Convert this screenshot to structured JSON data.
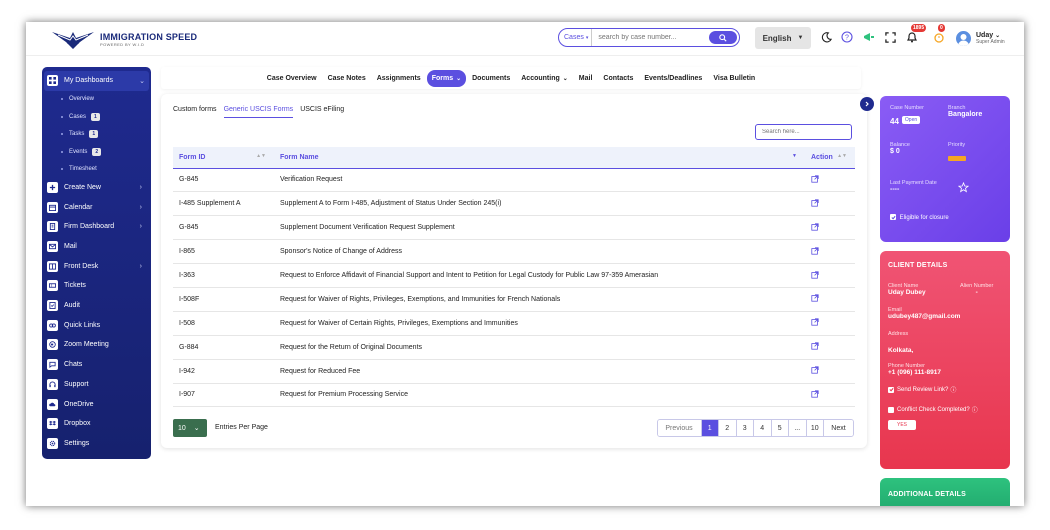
{
  "header": {
    "logo_title": "IMMIGRATION SPEED",
    "logo_sub": "POWERED BY W.I.D",
    "search_scope": "Cases",
    "search_placeholder": "search by case number...",
    "language": "English",
    "notification_count": "1895",
    "reminder_count": "0",
    "user_name": "Uday",
    "user_role": "Super Admin"
  },
  "sidebar": {
    "dashboard_label": "My Dashboards",
    "dashboard_sub": [
      {
        "label": "Overview",
        "count": ""
      },
      {
        "label": "Cases",
        "count": "1"
      },
      {
        "label": "Tasks",
        "count": "1"
      },
      {
        "label": "Events",
        "count": "2"
      },
      {
        "label": "Timesheet",
        "count": ""
      }
    ],
    "items": [
      {
        "label": "Create New",
        "icon": "plus-icon",
        "chevron": true
      },
      {
        "label": "Calendar",
        "icon": "calendar-icon",
        "chevron": true
      },
      {
        "label": "Firm Dashboard",
        "icon": "building-icon",
        "chevron": true
      },
      {
        "label": "Mail",
        "icon": "mail-icon",
        "chevron": false
      },
      {
        "label": "Front Desk",
        "icon": "desk-icon",
        "chevron": true
      },
      {
        "label": "Tickets",
        "icon": "ticket-icon",
        "chevron": false
      },
      {
        "label": "Audit",
        "icon": "audit-icon",
        "chevron": false
      },
      {
        "label": "Quick Links",
        "icon": "link-icon",
        "chevron": false
      },
      {
        "label": "Zoom Meeting",
        "icon": "video-icon",
        "chevron": false
      },
      {
        "label": "Chats",
        "icon": "chat-icon",
        "chevron": false
      },
      {
        "label": "Support",
        "icon": "support-icon",
        "chevron": false
      },
      {
        "label": "OneDrive",
        "icon": "cloud-icon",
        "chevron": false
      },
      {
        "label": "Dropbox",
        "icon": "dropbox-icon",
        "chevron": false
      },
      {
        "label": "Settings",
        "icon": "gear-icon",
        "chevron": false
      }
    ]
  },
  "tabs": [
    "Case Overview",
    "Case Notes",
    "Assignments",
    "Forms",
    "Documents",
    "Accounting",
    "Mail",
    "Contacts",
    "Events/Deadlines",
    "Visa Bulletin"
  ],
  "active_tab": "Forms",
  "subtabs": [
    "Custom forms",
    "Generic USCIS Forms",
    "USCIS eFiling"
  ],
  "active_subtab": "Generic USCIS Forms",
  "table": {
    "search_placeholder": "Search here...",
    "headers": {
      "id": "Form ID",
      "name": "Form Name",
      "action": "Action"
    },
    "rows": [
      {
        "id": "G-845",
        "name": "Verification Request"
      },
      {
        "id": "I-485 Supplement A",
        "name": "Supplement A to Form I-485, Adjustment of Status Under Section 245(i)"
      },
      {
        "id": "G-845",
        "name": "Supplement Document Verification Request Supplement"
      },
      {
        "id": "I-865",
        "name": "Sponsor's Notice of Change of Address"
      },
      {
        "id": "I-363",
        "name": "Request to Enforce Affidavit of Financial Support and Intent to Petition for Legal Custody for Public Law 97-359 Amerasian"
      },
      {
        "id": "I-508F",
        "name": "Request for Waiver of Rights, Privileges, Exemptions, and Immunities for French Nationals"
      },
      {
        "id": "I-508",
        "name": "Request for Waiver of Certain Rights, Privileges, Exemptions and Immunities"
      },
      {
        "id": "G-884",
        "name": "Request for the Return of Original Documents"
      },
      {
        "id": "I-942",
        "name": "Request for Reduced Fee"
      },
      {
        "id": "I-907",
        "name": "Request for Premium Processing Service"
      }
    ],
    "per_page_value": "10",
    "per_page_label": "Entries Per Page",
    "pagination": [
      "Previous",
      "1",
      "2",
      "3",
      "4",
      "5",
      "...",
      "10",
      "Next"
    ],
    "active_page": "1"
  },
  "case_card": {
    "case_number_label": "Case Number",
    "case_number": "44",
    "status": "Open",
    "branch_label": "Branch",
    "branch": "Bangalore",
    "balance_label": "Balance",
    "balance": "$ 0",
    "priority_label": "Priority",
    "last_payment_label": "Last Payment Date",
    "last_payment": "----",
    "eligible_label": "Eligible for closure"
  },
  "client_card": {
    "title": "CLIENT DETAILS",
    "client_name_label": "Client Name",
    "client_name": "Uday Dubey",
    "alien_label": "Alien Number",
    "alien": "-",
    "email_label": "Email",
    "email": "udubey487@gmail.com",
    "address_label": "Address",
    "address": "Kolkata,",
    "phone_label": "Phone Number",
    "phone": "+1 (096) 111-8917",
    "review_label": "Send Review Link?",
    "conflict_label": "Conflict Check Completed?",
    "yes_label": "YES"
  },
  "additional_card": {
    "title": "ADDITIONAL DETAILS"
  },
  "colors": {
    "accent": "#5b4fe0",
    "sidebar": "#1f2a8f",
    "case_card": "#7b4df0",
    "client_card": "#ec4560",
    "additional": "#28b874"
  }
}
